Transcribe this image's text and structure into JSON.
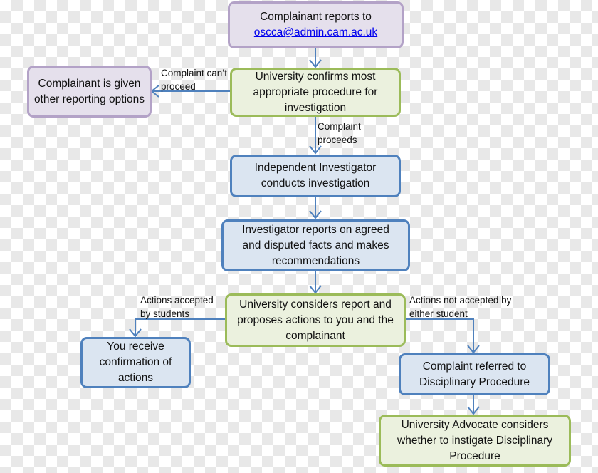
{
  "colors": {
    "arrow": "#4f81bd",
    "purple_border": "#b3a2c7",
    "green_border": "#9bbb59",
    "blue_border": "#4f81bd"
  },
  "nodes": {
    "report": {
      "line1": "Complainant reports to",
      "email": "oscca@admin.cam.ac.uk"
    },
    "other_options": {
      "text": "Complainant is given other reporting options"
    },
    "confirm": {
      "text": "University confirms most appropriate procedure for investigation"
    },
    "investigator": {
      "text": "Independent Investigator conducts investigation"
    },
    "investigator_reports": {
      "text": "Investigator reports on agreed and disputed facts and makes recommendations"
    },
    "considers": {
      "text": "University considers report and proposes actions to you and the complainant"
    },
    "confirmation": {
      "text": "You receive confirmation of actions"
    },
    "referred": {
      "text": "Complaint referred to Disciplinary Procedure"
    },
    "advocate": {
      "text": "University Advocate considers whether to instigate Disciplinary Procedure"
    }
  },
  "edge_labels": {
    "cant_proceed": "Complaint can’t proceed",
    "proceeds": "Complaint proceeds",
    "accepted": "Actions accepted by students",
    "not_accepted": "Actions not accepted by either student"
  }
}
